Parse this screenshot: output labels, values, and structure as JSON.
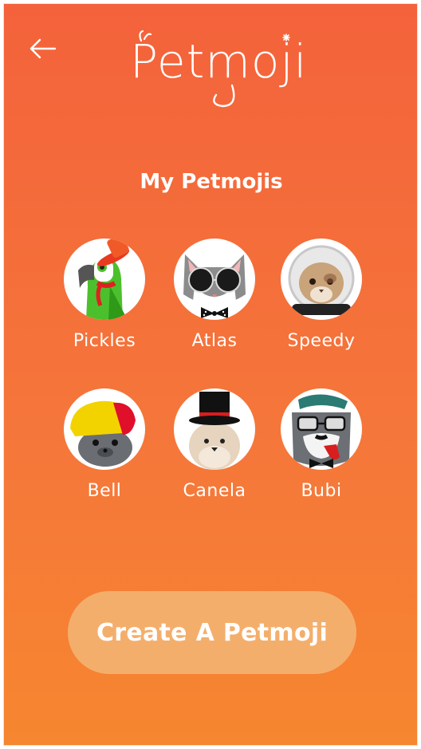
{
  "header": {
    "back_icon": "arrow-left-icon",
    "logo_text": "Petmoji"
  },
  "section_title": "My Petmojis",
  "pets": [
    {
      "name": "Pickles",
      "avatar": "parrot-with-hat"
    },
    {
      "name": "Atlas",
      "avatar": "cat-with-sunglasses"
    },
    {
      "name": "Speedy",
      "avatar": "hamster-astronaut"
    },
    {
      "name": "Bell",
      "avatar": "seal-with-turban"
    },
    {
      "name": "Canela",
      "avatar": "dog-with-top-hat"
    },
    {
      "name": "Bubi",
      "avatar": "schnauzer-with-pipe"
    }
  ],
  "create_button_label": "Create A Petmoji",
  "colors": {
    "background_top": "#F4623B",
    "background_bottom": "#F6862F",
    "button": "#F4AE6C",
    "text": "#FFFFFF"
  }
}
